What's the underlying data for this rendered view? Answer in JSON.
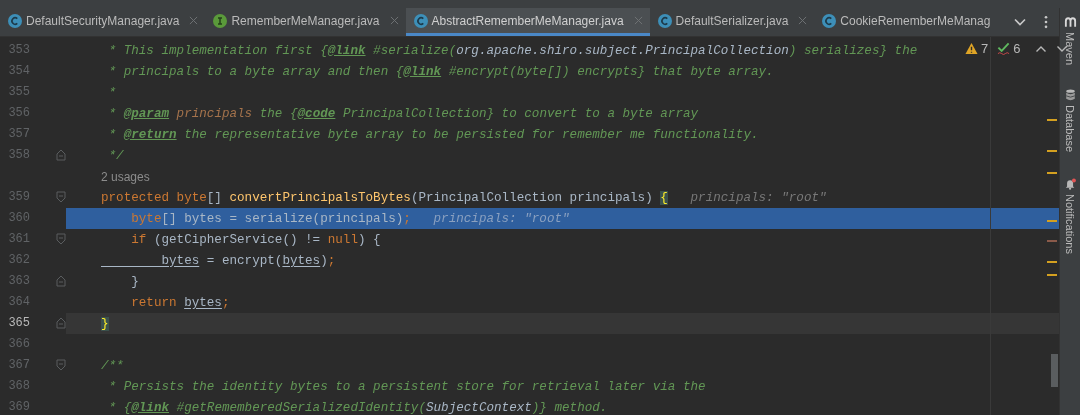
{
  "tabs": [
    {
      "label": "DefaultSecurityManager.java",
      "kind": "class",
      "selected": false,
      "closable": true
    },
    {
      "label": "RememberMeManager.java",
      "kind": "interface",
      "selected": false,
      "closable": true
    },
    {
      "label": "AbstractRememberMeManager.java",
      "kind": "class",
      "selected": true,
      "closable": true
    },
    {
      "label": "DefaultSerializer.java",
      "kind": "class",
      "selected": false,
      "closable": true
    },
    {
      "label": "CookieRememberMeManag",
      "kind": "class",
      "selected": false,
      "closable": false
    }
  ],
  "problems": {
    "warnings": "7",
    "checks": "6"
  },
  "lines": [
    {
      "kind": "code",
      "number": "353",
      "current": false,
      "fold_start": false,
      "fold_end": false,
      "tokens": [
        {
          "t": " * This implementation first {",
          "kind": "comment"
        },
        {
          "t": "@link",
          "kind": "tag"
        },
        {
          "t": " #serialize(",
          "kind": "comment"
        },
        {
          "t": "org.apache.shiro.subject.PrincipalCollection",
          "kind": "reference"
        },
        {
          "t": ") serializes} the",
          "kind": "comment"
        }
      ]
    },
    {
      "kind": "code",
      "number": "354",
      "current": false,
      "fold_start": false,
      "fold_end": false,
      "tokens": [
        {
          "t": " * principals to a byte array and then {",
          "kind": "comment"
        },
        {
          "t": "@link",
          "kind": "tag"
        },
        {
          "t": " #encrypt(byte[]) encrypts} that byte array.",
          "kind": "comment"
        }
      ]
    },
    {
      "kind": "code",
      "number": "355",
      "current": false,
      "fold_start": false,
      "fold_end": false,
      "tokens": [
        {
          "t": " *",
          "kind": "comment"
        }
      ]
    },
    {
      "kind": "code",
      "number": "356",
      "current": false,
      "fold_start": false,
      "fold_end": false,
      "tokens": [
        {
          "t": " * ",
          "kind": "comment"
        },
        {
          "t": "@param",
          "kind": "tag"
        },
        {
          "t": " principals",
          "kind": "parameter"
        },
        {
          "t": " the {",
          "kind": "comment"
        },
        {
          "t": "@code",
          "kind": "tag"
        },
        {
          "t": " PrincipalCollection} to convert to a byte array",
          "kind": "comment"
        }
      ]
    },
    {
      "kind": "code",
      "number": "357",
      "current": false,
      "fold_start": false,
      "fold_end": false,
      "tokens": [
        {
          "t": " * ",
          "kind": "comment"
        },
        {
          "t": "@return",
          "kind": "tag"
        },
        {
          "t": " the representative byte array to be persisted for remember me functionality.",
          "kind": "comment"
        }
      ]
    },
    {
      "kind": "code",
      "number": "358",
      "current": false,
      "fold_start": false,
      "fold_end": true,
      "tokens": [
        {
          "t": " */",
          "kind": "comment"
        }
      ]
    },
    {
      "kind": "usages",
      "text": "2 usages"
    },
    {
      "kind": "code",
      "number": "359",
      "current": false,
      "fold_start": true,
      "fold_end": false,
      "tokens": [
        {
          "t": "protected byte",
          "kind": "keyword"
        },
        {
          "t": "[] ",
          "kind": "plain"
        },
        {
          "t": "convertPrincipalsToBytes",
          "kind": "method"
        },
        {
          "t": "(PrincipalCollection principals) ",
          "kind": "plain"
        },
        {
          "t": "{",
          "kind": "brace"
        },
        {
          "t": "   principals: \"root\"",
          "kind": "hint"
        }
      ]
    },
    {
      "kind": "execution",
      "number": "360",
      "current": false,
      "fold_start": false,
      "fold_end": false,
      "tokens": [
        {
          "t": "    byte",
          "kind": "keyword"
        },
        {
          "t": "[] bytes = serialize(principals)",
          "kind": "plain"
        },
        {
          "t": ";",
          "kind": "keyword"
        },
        {
          "t": "   principals: \"root\"",
          "kind": "hint"
        }
      ]
    },
    {
      "kind": "code",
      "number": "361",
      "current": false,
      "fold_start": true,
      "fold_end": false,
      "tokens": [
        {
          "t": "    if ",
          "kind": "keyword"
        },
        {
          "t": "(getCipherService() != ",
          "kind": "plain"
        },
        {
          "t": "null",
          "kind": "keyword"
        },
        {
          "t": ") {",
          "kind": "plain"
        }
      ]
    },
    {
      "kind": "code",
      "number": "362",
      "current": false,
      "fold_start": false,
      "fold_end": false,
      "tokens": [
        {
          "t": "        bytes",
          "kind": "field"
        },
        {
          "t": " = encrypt(",
          "kind": "plain"
        },
        {
          "t": "bytes",
          "kind": "field"
        },
        {
          "t": ")",
          "kind": "plain"
        },
        {
          "t": ";",
          "kind": "keyword"
        }
      ]
    },
    {
      "kind": "code",
      "number": "363",
      "current": false,
      "fold_start": false,
      "fold_end": true,
      "tokens": [
        {
          "t": "    }",
          "kind": "plain"
        }
      ]
    },
    {
      "kind": "code",
      "number": "364",
      "current": false,
      "fold_start": false,
      "fold_end": false,
      "tokens": [
        {
          "t": "    return ",
          "kind": "keyword"
        },
        {
          "t": "bytes",
          "kind": "field"
        },
        {
          "t": ";",
          "kind": "keyword"
        }
      ]
    },
    {
      "kind": "code",
      "number": "365",
      "current": true,
      "fold_start": false,
      "fold_end": true,
      "tokens": [
        {
          "t": "}",
          "kind": "brace"
        }
      ]
    },
    {
      "kind": "code",
      "number": "366",
      "current": false,
      "fold_start": false,
      "fold_end": false
    },
    {
      "kind": "code",
      "number": "367",
      "current": false,
      "fold_start": true,
      "fold_end": false,
      "tokens": [
        {
          "t": "/**",
          "kind": "comment"
        }
      ]
    },
    {
      "kind": "code",
      "number": "368",
      "current": false,
      "fold_start": false,
      "fold_end": false,
      "tokens": [
        {
          "t": " * Persists the identity bytes to a persistent store for retrieval later via the",
          "kind": "comment"
        }
      ]
    },
    {
      "kind": "code",
      "number": "369",
      "current": false,
      "fold_start": false,
      "fold_end": false,
      "tokens": [
        {
          "t": " * {",
          "kind": "comment"
        },
        {
          "t": "@link",
          "kind": "tag"
        },
        {
          "t": " #getRememberedSerializedIdentity(",
          "kind": "comment"
        },
        {
          "t": "SubjectContext",
          "kind": "reference"
        },
        {
          "t": ")} method.",
          "kind": "comment"
        }
      ]
    }
  ],
  "tool_windows": [
    {
      "label": "Maven",
      "kind": "maven"
    },
    {
      "label": "Database",
      "kind": "database"
    },
    {
      "label": "Notifications",
      "kind": "notifications"
    }
  ]
}
